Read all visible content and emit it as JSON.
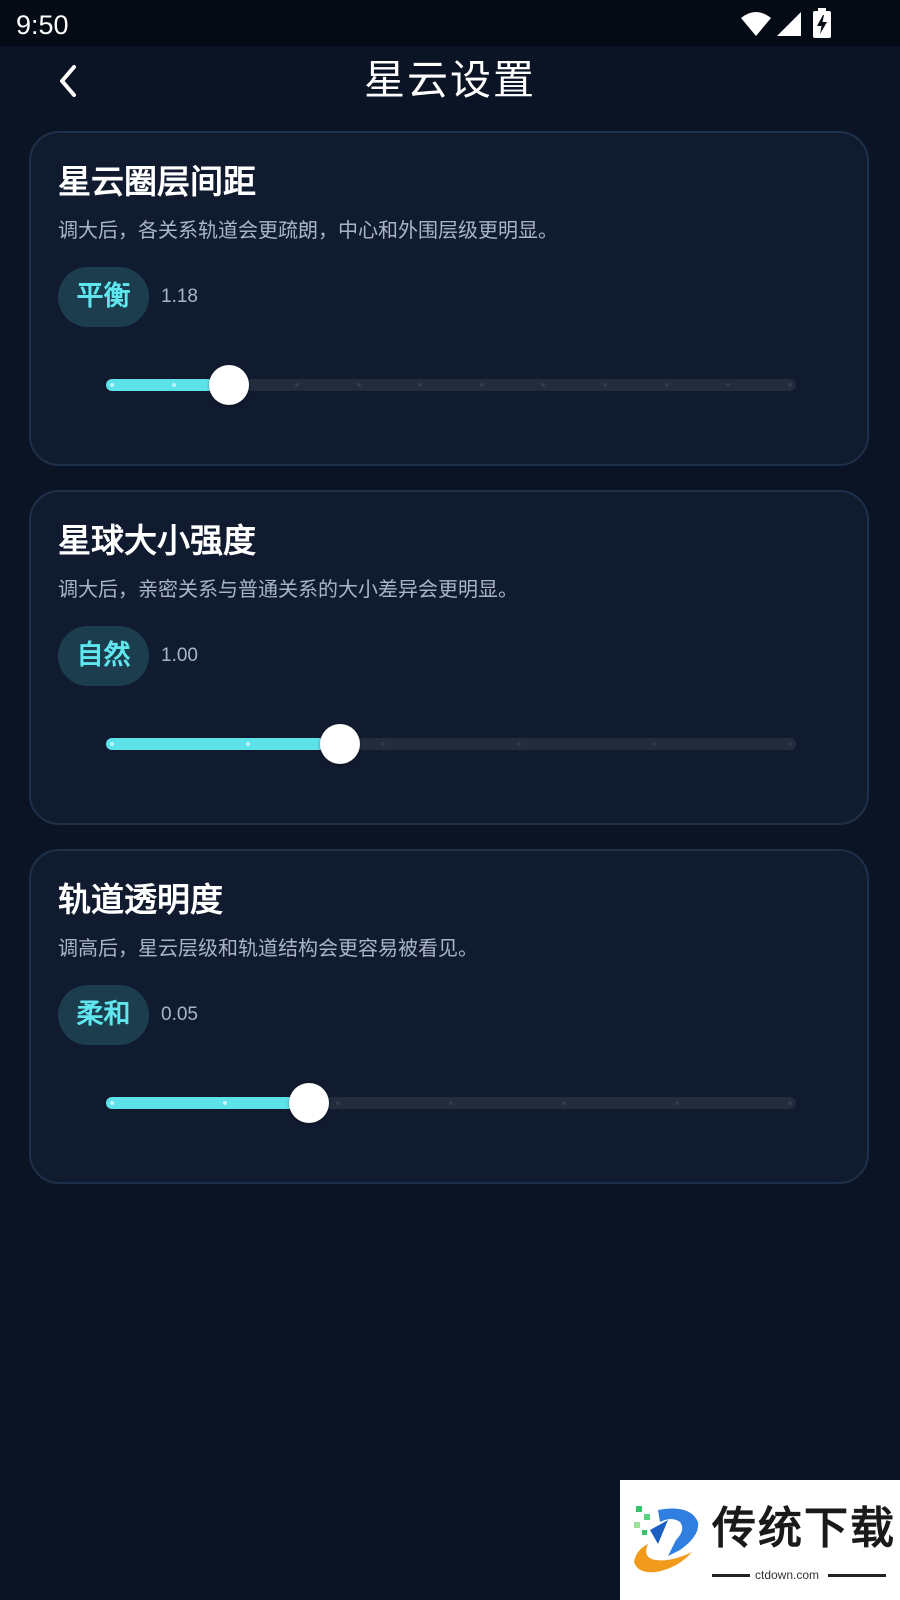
{
  "status_bar": {
    "time": "9:50",
    "icons": [
      "wifi-icon",
      "cell-signal-icon",
      "battery-charging-icon"
    ]
  },
  "header": {
    "title": "星云设置",
    "back_icon": "chevron-left-icon"
  },
  "settings": [
    {
      "title": "星云圈层间距",
      "description": "调大后，各关系轨道会更疏朗，中心和外围层级更明显。",
      "level": "平衡",
      "value": "1.18",
      "slider_fraction": 0.173,
      "steps": 12
    },
    {
      "title": "星球大小强度",
      "description": "调大后，亲密关系与普通关系的大小差异会更明显。",
      "level": "自然",
      "value": "1.00",
      "slider_fraction": 0.337,
      "steps": 6
    },
    {
      "title": "轨道透明度",
      "description": "调高后，星云层级和轨道结构会更容易被看见。",
      "level": "柔和",
      "value": "0.05",
      "slider_fraction": 0.29,
      "steps": 7
    }
  ],
  "watermark": {
    "brand": "传统下载",
    "site": "ctdown.com"
  },
  "colors": {
    "background": "#0b1424",
    "card": "#111b30",
    "accent": "#5ee2ea",
    "badge_bg": "#1c3d4e",
    "muted_text": "#a9b5c6"
  }
}
